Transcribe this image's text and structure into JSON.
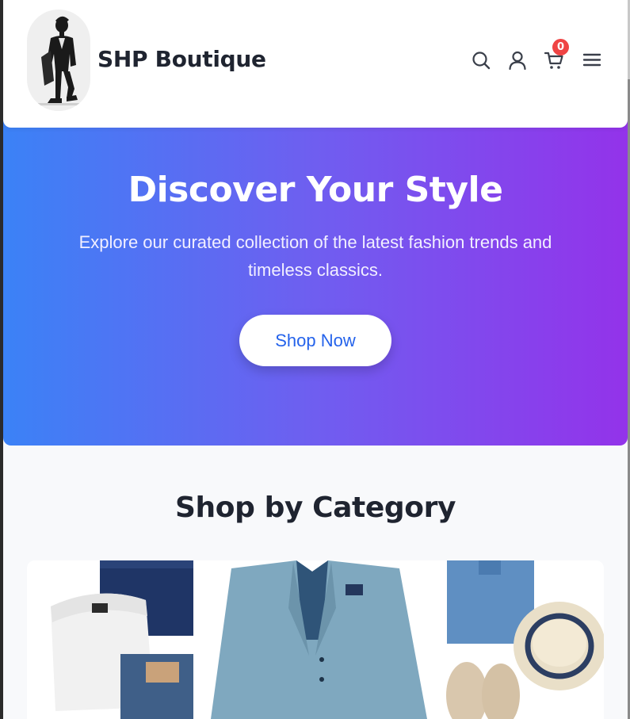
{
  "header": {
    "brand": "SHP Boutique",
    "logo_icon": "fashion-model-logo",
    "icons": [
      "search-icon",
      "user-icon",
      "cart-icon",
      "menu-icon"
    ],
    "cart_count": "0"
  },
  "hero": {
    "title": "Discover Your Style",
    "subtitle": "Explore our curated collection of the latest fashion trends and timeless classics.",
    "cta_label": "Shop Now",
    "gradient": [
      "#3b82f6",
      "#9333ea"
    ]
  },
  "categories": {
    "title": "Shop by Category"
  },
  "colors": {
    "accent": "#2563eb",
    "badge": "#ef4444",
    "text_dark": "#1f2430"
  }
}
